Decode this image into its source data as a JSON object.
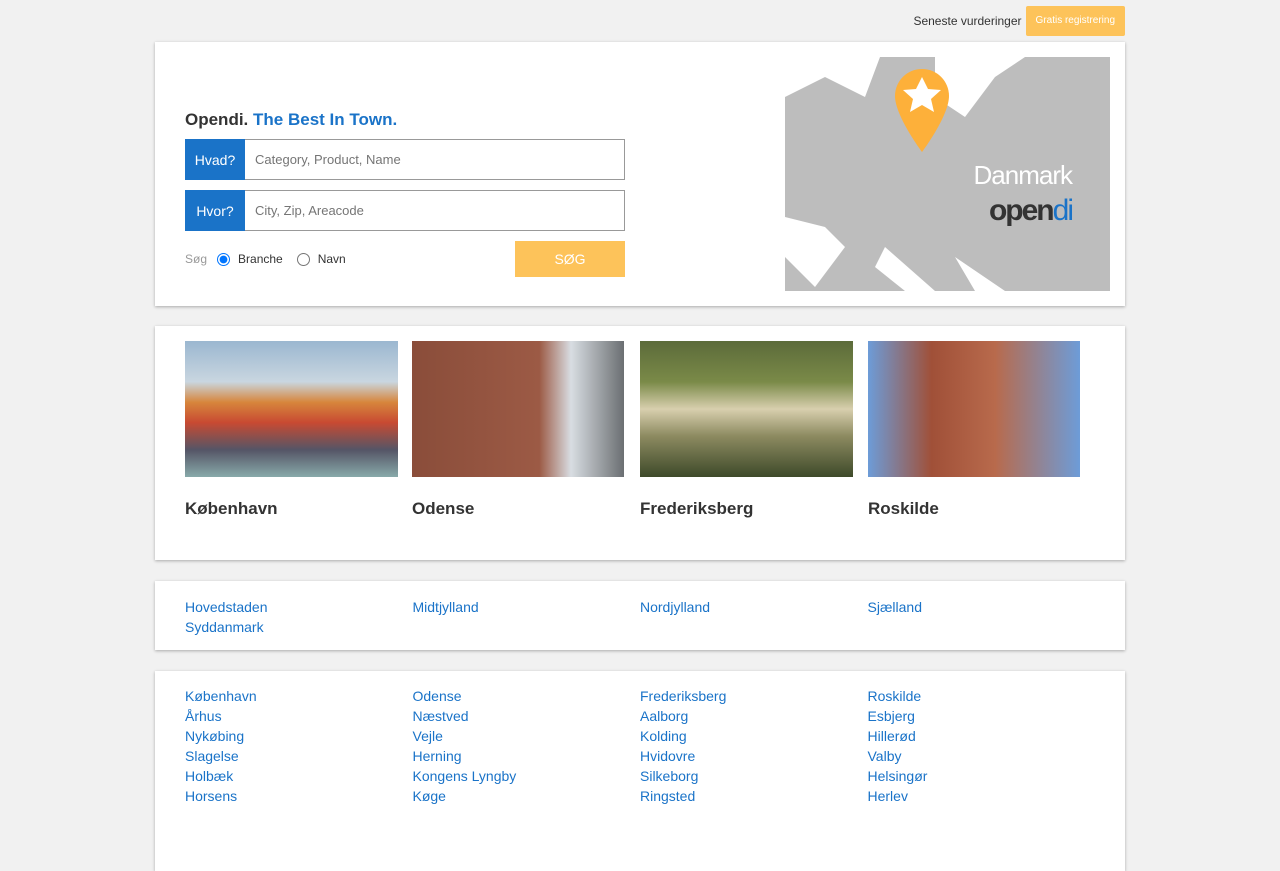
{
  "topbar": {
    "latest_reviews": "Seneste vurderinger",
    "register": "Gratis registrering"
  },
  "search": {
    "brand": "Opendi.",
    "tagline": "The Best In Town.",
    "what_label": "Hvad?",
    "what_placeholder": "Category, Product, Name",
    "where_label": "Hvor?",
    "where_placeholder": "City, Zip, Areacode",
    "search_by": "Søg",
    "option_branche": "Branche",
    "option_navn": "Navn",
    "submit": "SØG"
  },
  "map": {
    "country": "Danmark",
    "logo_open": "open",
    "logo_di": "di"
  },
  "featured": [
    {
      "name": "København"
    },
    {
      "name": "Odense"
    },
    {
      "name": "Frederiksberg"
    },
    {
      "name": "Roskilde"
    }
  ],
  "regions": [
    "Hovedstaden",
    "Midtjylland",
    "Nordjylland",
    "Sjælland",
    "Syddanmark"
  ],
  "cities": [
    "København",
    "Odense",
    "Frederiksberg",
    "Roskilde",
    "Århus",
    "Næstved",
    "Aalborg",
    "Esbjerg",
    "Nykøbing",
    "Vejle",
    "Kolding",
    "Hillerød",
    "Slagelse",
    "Herning",
    "Hvidovre",
    "Valby",
    "Holbæk",
    "Kongens Lyngby",
    "Silkeborg",
    "Helsingør",
    "Horsens",
    "Køge",
    "Ringsted",
    "Herlev"
  ]
}
